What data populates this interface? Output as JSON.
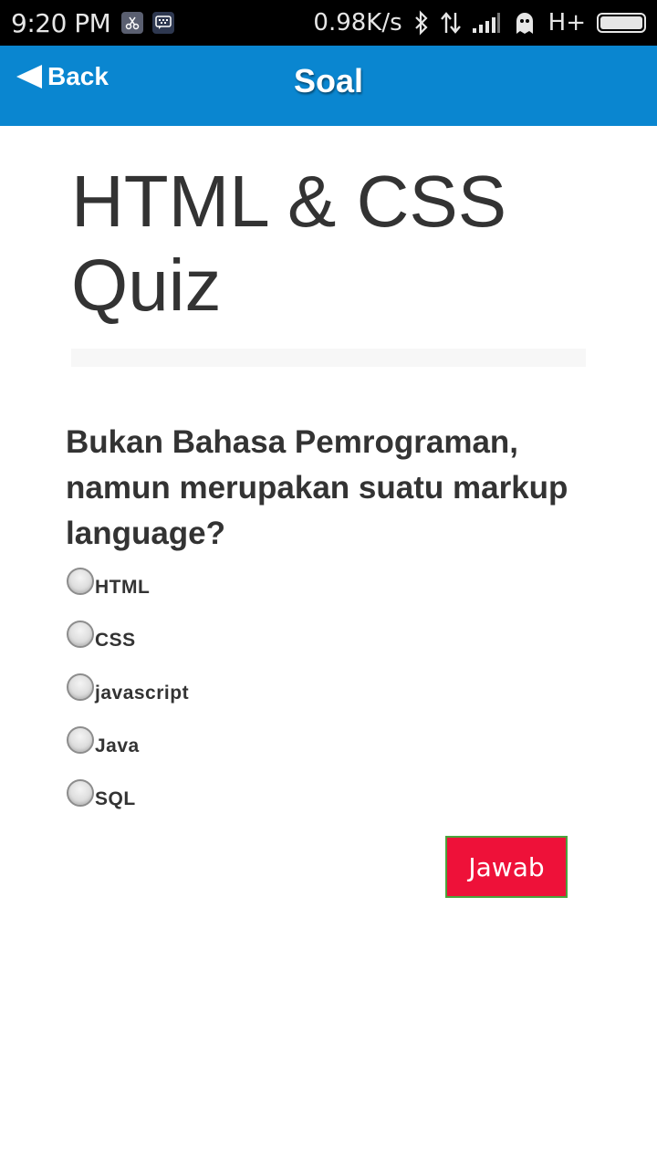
{
  "status_bar": {
    "time": "9:20 PM",
    "notification_icons": [
      "scissors-app-icon",
      "bbm-icon"
    ],
    "network_speed": "0.98K/s",
    "network_type": "H+",
    "icons": [
      "bluetooth-icon",
      "data-transfer-icon",
      "signal-icon",
      "ghost-icon",
      "battery-icon"
    ]
  },
  "header": {
    "back_label": "Back",
    "title": "Soal",
    "color": "#0a86d0"
  },
  "quiz": {
    "title": "HTML & CSS Quiz",
    "question": "Bukan Bahasa Pemrograman, namun merupakan suatu markup language?",
    "options": [
      {
        "label": "HTML",
        "selected": false
      },
      {
        "label": "CSS",
        "selected": false
      },
      {
        "label": "javascript",
        "selected": false
      },
      {
        "label": "Java",
        "selected": false
      },
      {
        "label": "SQL",
        "selected": false
      }
    ],
    "submit_label": "Jawab",
    "submit_color": "#ee1139"
  }
}
